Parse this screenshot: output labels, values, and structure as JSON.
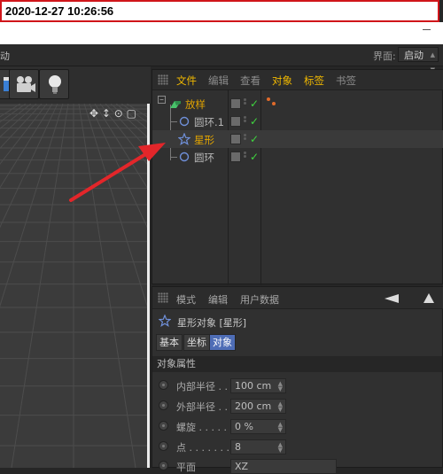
{
  "timestamp": "2020-12-27  10:26:56",
  "menubar": {
    "left_text": "动",
    "ui_label": "界面:",
    "ui_value": "启动"
  },
  "toolbar": {
    "buttons": [
      {
        "icon": "film-clapper-icon"
      },
      {
        "icon": "camera-icon"
      },
      {
        "icon": "light-bulb-icon"
      }
    ]
  },
  "viewport": {
    "nav_icons": "✥ ↕ ⊙ ▢"
  },
  "object_manager": {
    "menu": [
      "文件",
      "编辑",
      "查看",
      "对象",
      "标签",
      "书签"
    ],
    "menu_active": [
      true,
      false,
      false,
      true,
      true,
      false
    ],
    "objects": [
      {
        "name": "放样",
        "icon": "loft-icon",
        "color": "#e2a400",
        "indent": 0
      },
      {
        "name": "圆环.1",
        "icon": "circle-spline-icon",
        "color": "#b5b5b5",
        "indent": 1
      },
      {
        "name": "星形",
        "icon": "star-spline-icon",
        "color": "#e2a400",
        "indent": 1
      },
      {
        "name": "圆环",
        "icon": "circle-spline-icon",
        "color": "#b5b5b5",
        "indent": 1
      }
    ]
  },
  "attribute_manager": {
    "menu": [
      "模式",
      "编辑",
      "用户数据"
    ],
    "title": "星形对象 [星形]",
    "tabs": [
      "基本",
      "坐标",
      "对象"
    ],
    "active_tab": "对象",
    "section": "对象属性",
    "params": [
      {
        "label": "内部半径 . .",
        "value": "100 cm"
      },
      {
        "label": "外部半径 . .",
        "value": "200 cm"
      },
      {
        "label": "螺旋 . . . . . .",
        "value": "0 %"
      },
      {
        "label": "点 . . . . . . . .",
        "value": "8"
      },
      {
        "label": "平面",
        "value": "XZ"
      }
    ]
  },
  "colors": {
    "accent": "#4e6db6",
    "highlight": "#f0b800",
    "arrow": "#e3262a",
    "check": "#3fd53f"
  }
}
